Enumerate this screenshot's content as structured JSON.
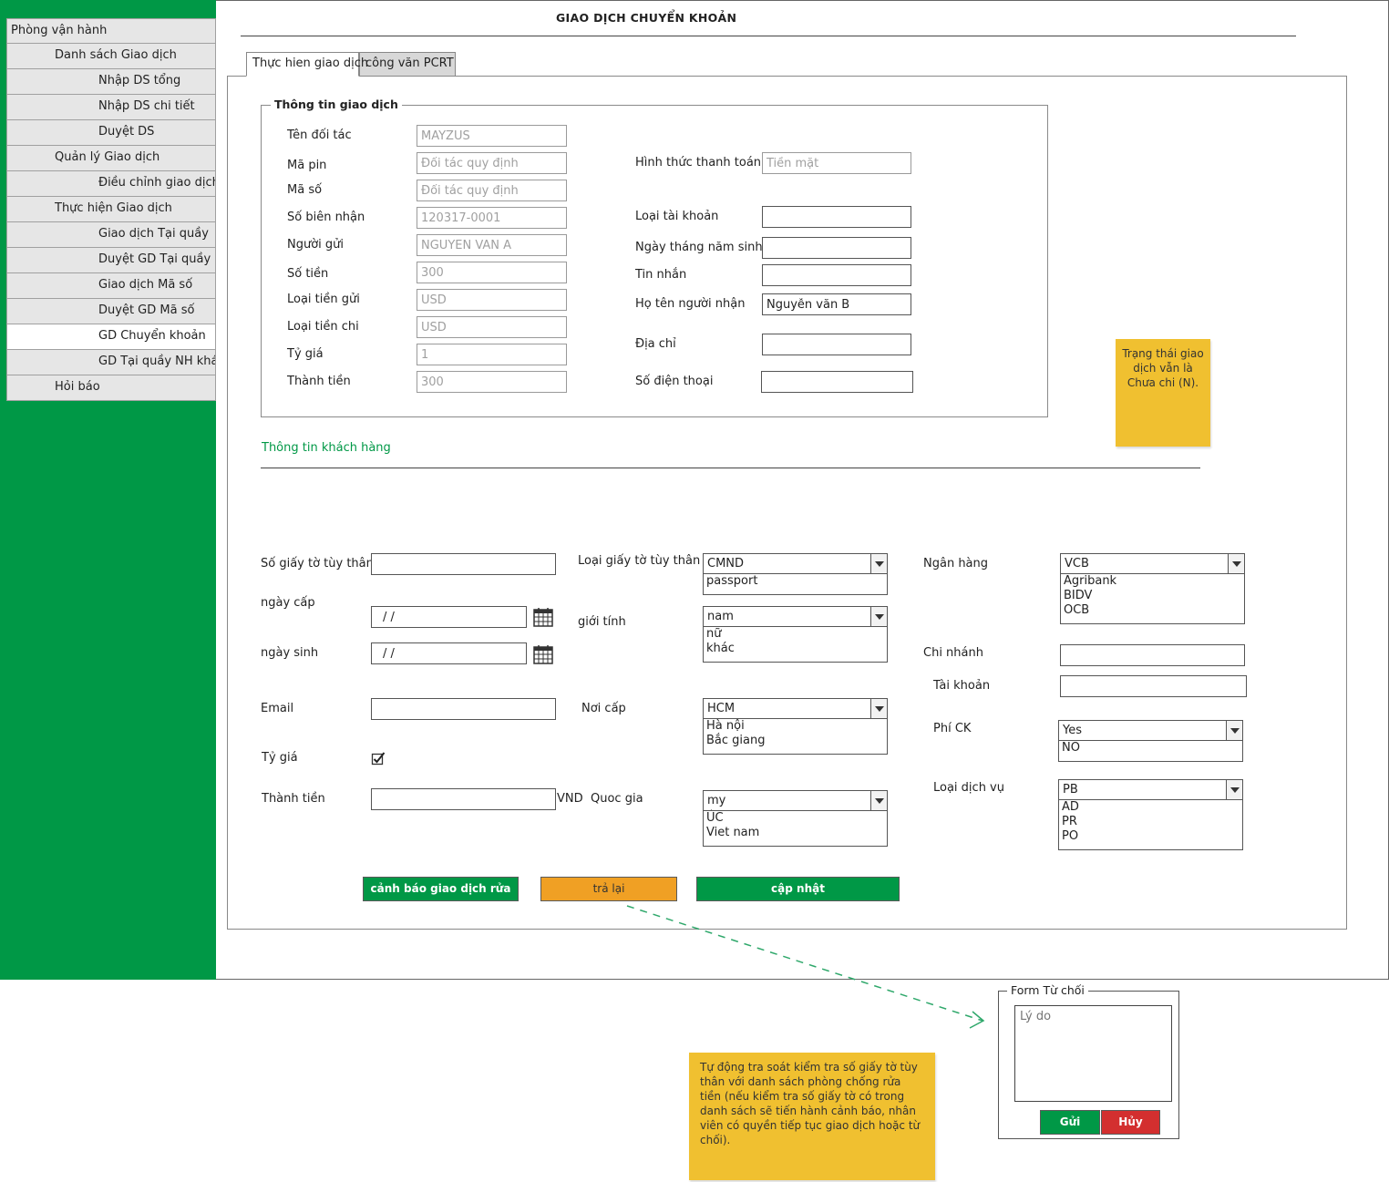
{
  "page": {
    "title": "GIAO DỊCH CHUYỂN KHOẢN"
  },
  "sidebar": {
    "items": [
      {
        "label": "Phòng vận hành"
      },
      {
        "label": "Danh sách Giao dịch"
      },
      {
        "label": "Nhập DS tổng"
      },
      {
        "label": "Nhập DS chi tiết"
      },
      {
        "label": "Duyệt DS"
      },
      {
        "label": "Quản lý Giao dịch"
      },
      {
        "label": "Điều chỉnh giao dịch"
      },
      {
        "label": "Thực hiện Giao dịch"
      },
      {
        "label": "Giao dịch Tại quầy"
      },
      {
        "label": "Duyệt GD Tại quầy"
      },
      {
        "label": "Giao dịch Mã số"
      },
      {
        "label": "Duyệt GD Mã số"
      },
      {
        "label": "GD Chuyển khoản"
      },
      {
        "label": "GD Tại quầy NH khác"
      },
      {
        "label": "Hỏi báo"
      }
    ]
  },
  "tabs": [
    {
      "label": "Thực hien giao dịch"
    },
    {
      "label": "công văn PCRT"
    }
  ],
  "transaction_info": {
    "legend": "Thông tin giao dịch",
    "left": {
      "partner_label": "Tên đối tác",
      "partner_value": "MAYZUS",
      "pin_label": "Mã pin",
      "pin_value": "Đối tác quy định",
      "code_label": "Mã số",
      "code_value": "Đối tác quy định",
      "receipt_label": "Số biên nhận",
      "receipt_value": "120317-0001",
      "sender_label": "Người gửi",
      "sender_value": "NGUYEN VAN A",
      "amount_label": "Số tiền",
      "amount_value": "300",
      "send_currency_label": "Loại tiền gửi",
      "send_currency_value": "USD",
      "pay_currency_label": "Loại tiền chi",
      "pay_currency_value": "USD",
      "rate_label": "Tỷ giá",
      "rate_value": "1",
      "total_label": "Thành tiền",
      "total_value": "300"
    },
    "right": {
      "payment_method_label": "Hình thức thanh toán",
      "payment_method_value": "Tiền mặt",
      "account_type_label": "Loại tài khoản",
      "account_type_value": "",
      "dob_label": "Ngày tháng năm sinh",
      "dob_value": "",
      "message_label": "Tin nhắn",
      "message_value": "",
      "receiver_label": "Họ tên người nhận",
      "receiver_value": "Nguyễn văn B",
      "address_label": "Địa chỉ",
      "address_value": "",
      "phone_label": "Số điện thoại",
      "phone_value": ""
    }
  },
  "sticky_status": "Trạng thái giao dịch vẫn là Chưa chi (N).",
  "customer": {
    "heading": "Thông tin khách hàng",
    "id_no_label": "Số giấy tờ tùy thân",
    "id_no_value": "",
    "issue_date_label": "ngày cấp",
    "issue_date_value": "/ /",
    "birth_date_label": "ngày sinh",
    "birth_date_value": "/ /",
    "email_label": "Email",
    "email_value": "",
    "rate_label": "Tỷ giá",
    "rate_checked": true,
    "total_label": "Thành tiền",
    "total_value": "",
    "total_unit": "VND",
    "id_type_label": "Loại giấy tờ tùy thân",
    "id_type_selected": "CMND",
    "id_type_options": [
      "passport"
    ],
    "gender_label": "giới tính",
    "gender_selected": "nam",
    "gender_options": [
      "nữ",
      "khác"
    ],
    "issue_place_label": "Nơi cấp",
    "issue_place_selected": "HCM",
    "issue_place_options": [
      "Hà nội",
      "Bắc giang"
    ],
    "country_label": "Quoc gia",
    "country_selected": "my",
    "country_options": [
      "ÚC",
      "Viet nam"
    ],
    "bank_label": "Ngân hàng",
    "bank_selected": "VCB",
    "bank_options": [
      "Agribank",
      "BIDV",
      "OCB"
    ],
    "branch_label": "Chi nhánh",
    "branch_value": "",
    "account_label": "Tài khoản",
    "account_value": "",
    "fee_label": "Phí CK",
    "fee_selected": "Yes",
    "fee_options": [
      "NO"
    ],
    "service_label": "Loại dịch vụ",
    "service_selected": "PB",
    "service_options": [
      "AD",
      "PR",
      "PO"
    ]
  },
  "actions": {
    "warn_label": "cảnh báo giao dịch rửa tiền",
    "return_label": "trả lại",
    "update_label": "cập nhật"
  },
  "reject_form": {
    "legend": "Form Từ chối",
    "reason_placeholder": "Lý do",
    "send_label": "Gửi",
    "cancel_label": "Hủy"
  },
  "sticky_note": "Tự động tra soát kiểm tra số giấy tờ tùy thân với danh sách phòng chống rửa tiền (nếu kiểm tra số giấy tờ có trong danh sách sẽ tiến hành cảnh báo, nhân viên có quyền tiếp tục giao dịch hoặc từ chối).",
  "colors": {
    "sidebar": "#009846",
    "accent_green": "#009846",
    "warning_orange": "#f0a024",
    "danger_red": "#d32f2f",
    "sticky_yellow": "#f0c030"
  }
}
